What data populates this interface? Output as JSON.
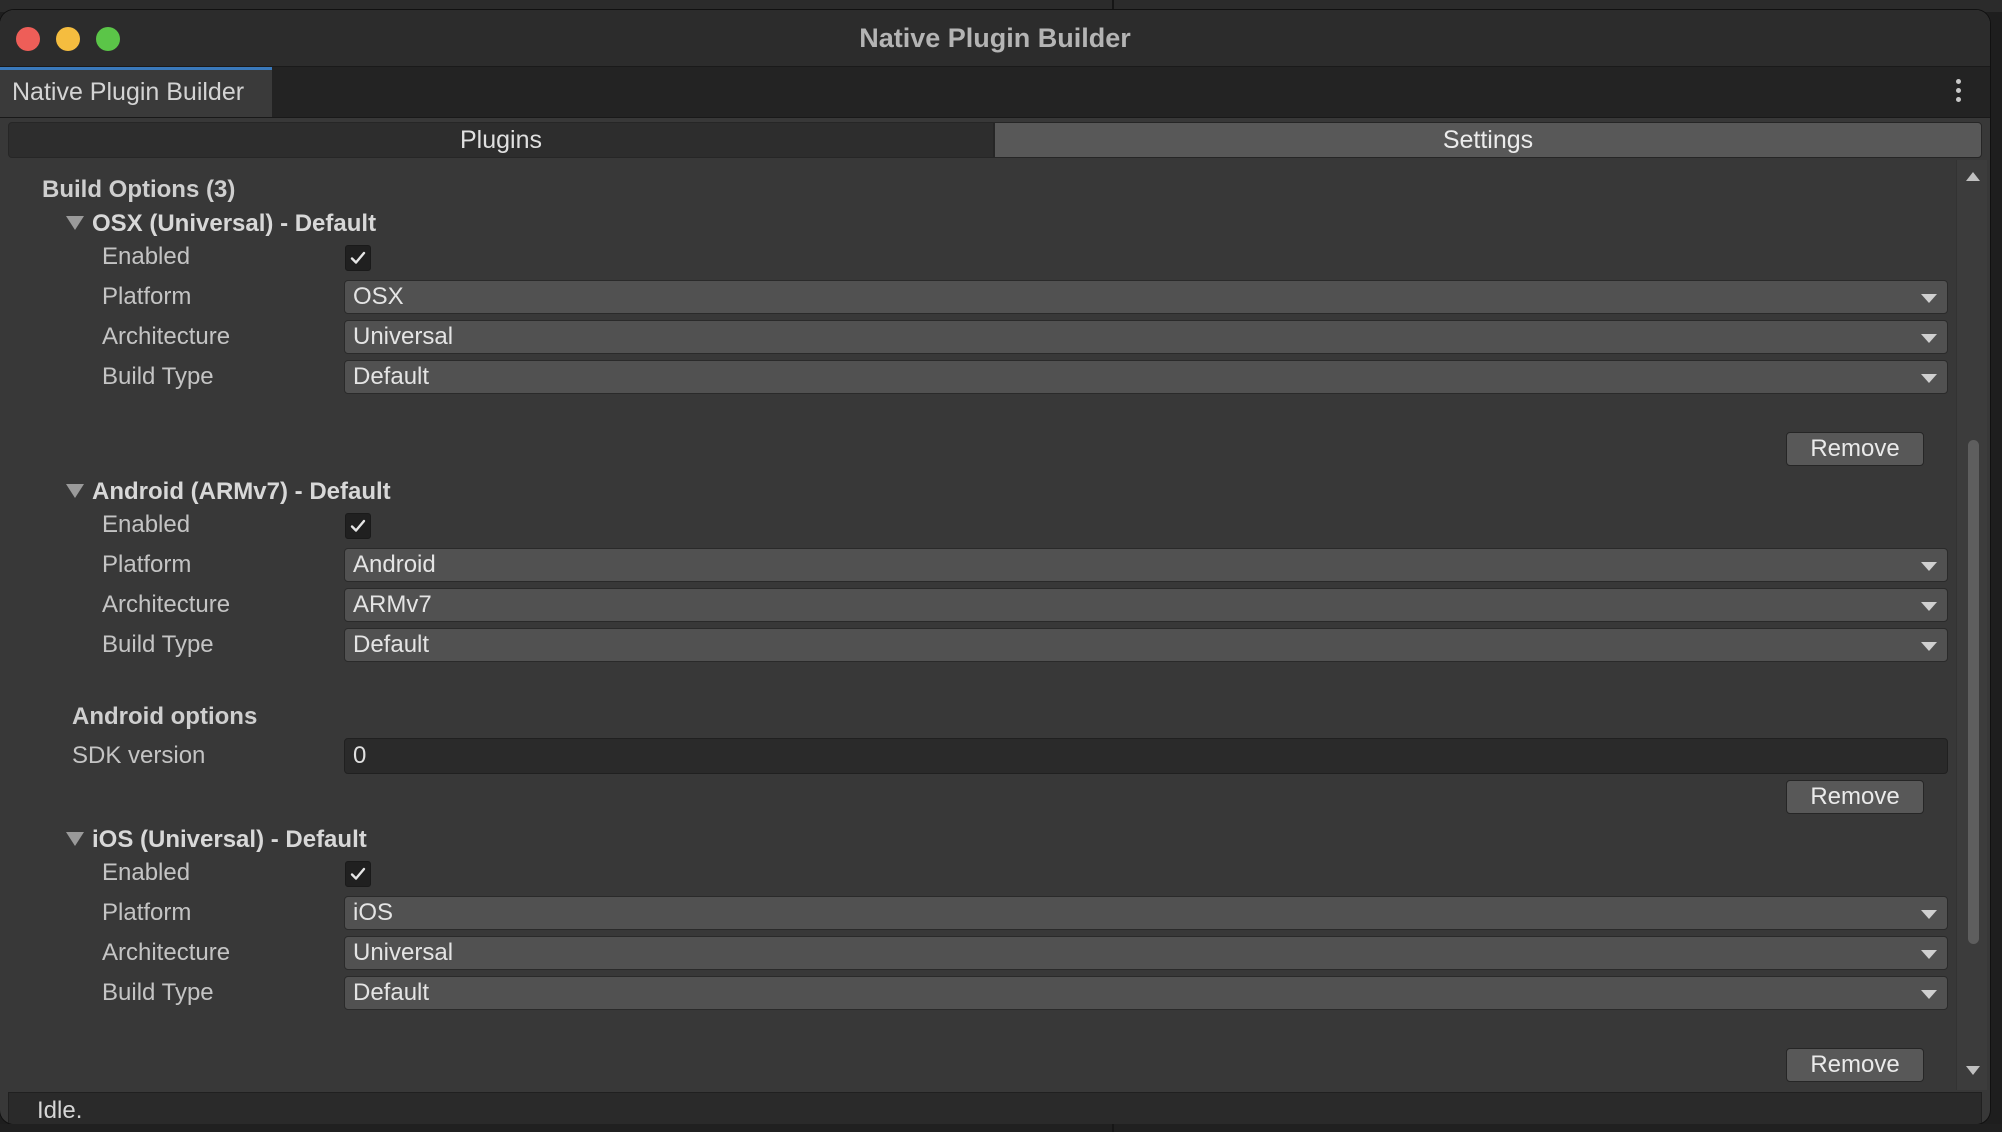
{
  "window": {
    "title": "Native Plugin Builder"
  },
  "editor_tab": {
    "label": "Native Plugin Builder"
  },
  "toolbar": {
    "plugins_label": "Plugins",
    "settings_label": "Settings",
    "active": "Plugins"
  },
  "build_options": {
    "title": "Build Options (3)",
    "items": [
      {
        "header": "OSX (Universal) - Default",
        "enabled_label": "Enabled",
        "enabled": true,
        "platform_label": "Platform",
        "platform": "OSX",
        "architecture_label": "Architecture",
        "architecture": "Universal",
        "build_type_label": "Build Type",
        "build_type": "Default",
        "remove_label": "Remove"
      },
      {
        "header": "Android (ARMv7) - Default",
        "enabled_label": "Enabled",
        "enabled": true,
        "platform_label": "Platform",
        "platform": "Android",
        "architecture_label": "Architecture",
        "architecture": "ARMv7",
        "build_type_label": "Build Type",
        "build_type": "Default",
        "options_title": "Android options",
        "sdk_label": "SDK version",
        "sdk_version": "0",
        "remove_label": "Remove"
      },
      {
        "header": "iOS (Universal) - Default",
        "enabled_label": "Enabled",
        "enabled": true,
        "platform_label": "Platform",
        "platform": "iOS",
        "architecture_label": "Architecture",
        "architecture": "Universal",
        "build_type_label": "Build Type",
        "build_type": "Default",
        "remove_label": "Remove"
      }
    ]
  },
  "status": {
    "text": "Idle."
  },
  "icons": {
    "close": "close-dot",
    "minimize": "minimize-dot",
    "maximize": "maximize-dot",
    "more": "kebab-menu-icon",
    "foldout": "triangle-down-icon",
    "dropdown": "chevron-down-icon",
    "check": "checkmark-icon"
  },
  "colors": {
    "close": "#ee5e58",
    "minimize": "#f5bd3f",
    "maximize": "#5bc548",
    "tab_accent": "#3a79bb"
  }
}
